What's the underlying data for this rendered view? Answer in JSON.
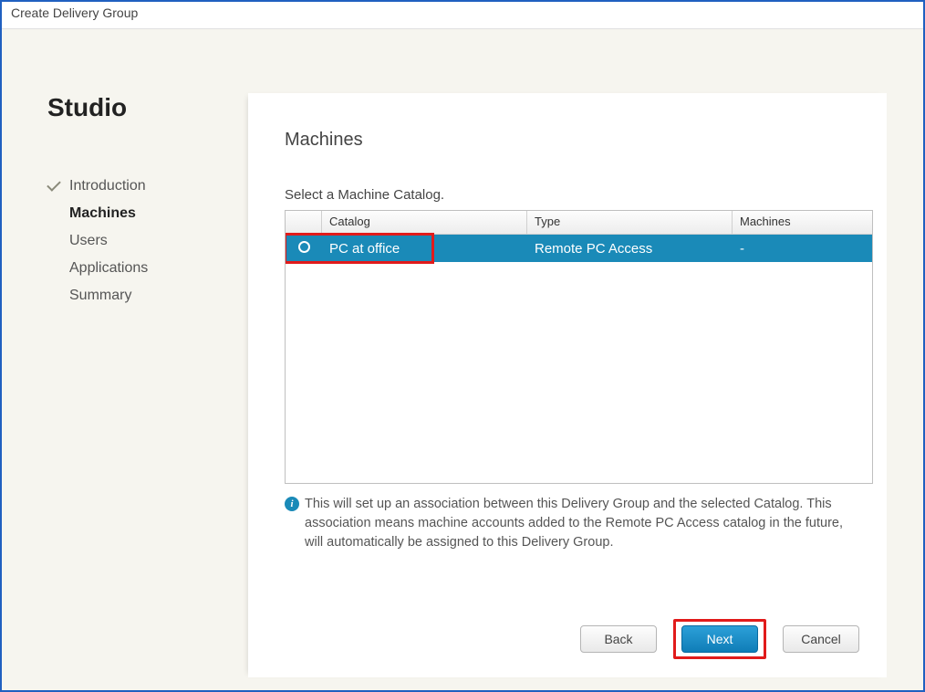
{
  "window": {
    "title": "Create Delivery Group"
  },
  "brand": "Studio",
  "nav": [
    {
      "label": "Introduction",
      "state": "completed"
    },
    {
      "label": "Machines",
      "state": "active"
    },
    {
      "label": "Users",
      "state": ""
    },
    {
      "label": "Applications",
      "state": ""
    },
    {
      "label": "Summary",
      "state": ""
    }
  ],
  "page": {
    "heading": "Machines",
    "section_label": "Select a Machine Catalog.",
    "columns": {
      "catalog": "Catalog",
      "type": "Type",
      "machines": "Machines"
    },
    "rows": [
      {
        "catalog": "PC at office",
        "type": "Remote PC Access",
        "machines": "-",
        "selected": true
      }
    ],
    "info_text": "This will set up an association between this Delivery Group and the selected Catalog. This association means machine accounts added to the Remote PC Access catalog in the future, will automatically be assigned to this Delivery Group."
  },
  "buttons": {
    "back": "Back",
    "next": "Next",
    "cancel": "Cancel"
  }
}
